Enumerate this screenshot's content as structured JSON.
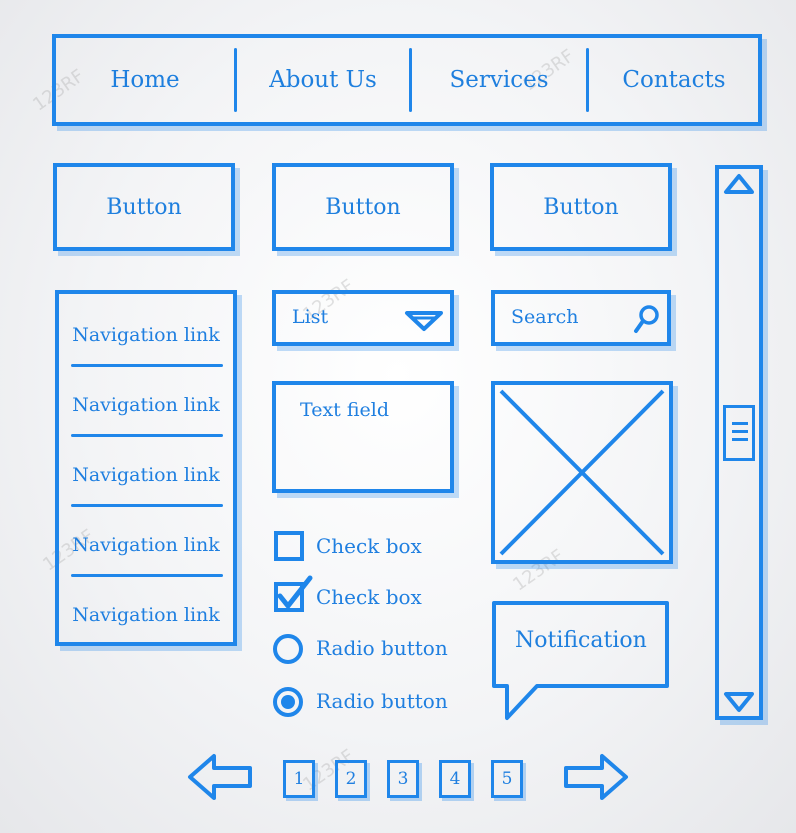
{
  "nav": {
    "items": [
      "Home",
      "About Us",
      "Services",
      "Contacts"
    ]
  },
  "buttons": [
    "Button",
    "Button",
    "Button"
  ],
  "sidebar": {
    "links": [
      "Navigation link",
      "Navigation link",
      "Navigation link",
      "Navigation link",
      "Navigation link"
    ]
  },
  "list": {
    "label": "List"
  },
  "search": {
    "placeholder": "Search"
  },
  "textfield": {
    "label": "Text field"
  },
  "checkboxes": [
    {
      "label": "Check box",
      "checked": false
    },
    {
      "label": "Check box",
      "checked": true
    }
  ],
  "radios": [
    {
      "label": "Radio button",
      "selected": false
    },
    {
      "label": "Radio button",
      "selected": true
    }
  ],
  "notification": {
    "text": "Notification"
  },
  "pagination": {
    "pages": [
      "1",
      "2",
      "3",
      "4",
      "5"
    ]
  },
  "colors": {
    "accent": "#1f86ea",
    "background": "#f1f2f4"
  }
}
